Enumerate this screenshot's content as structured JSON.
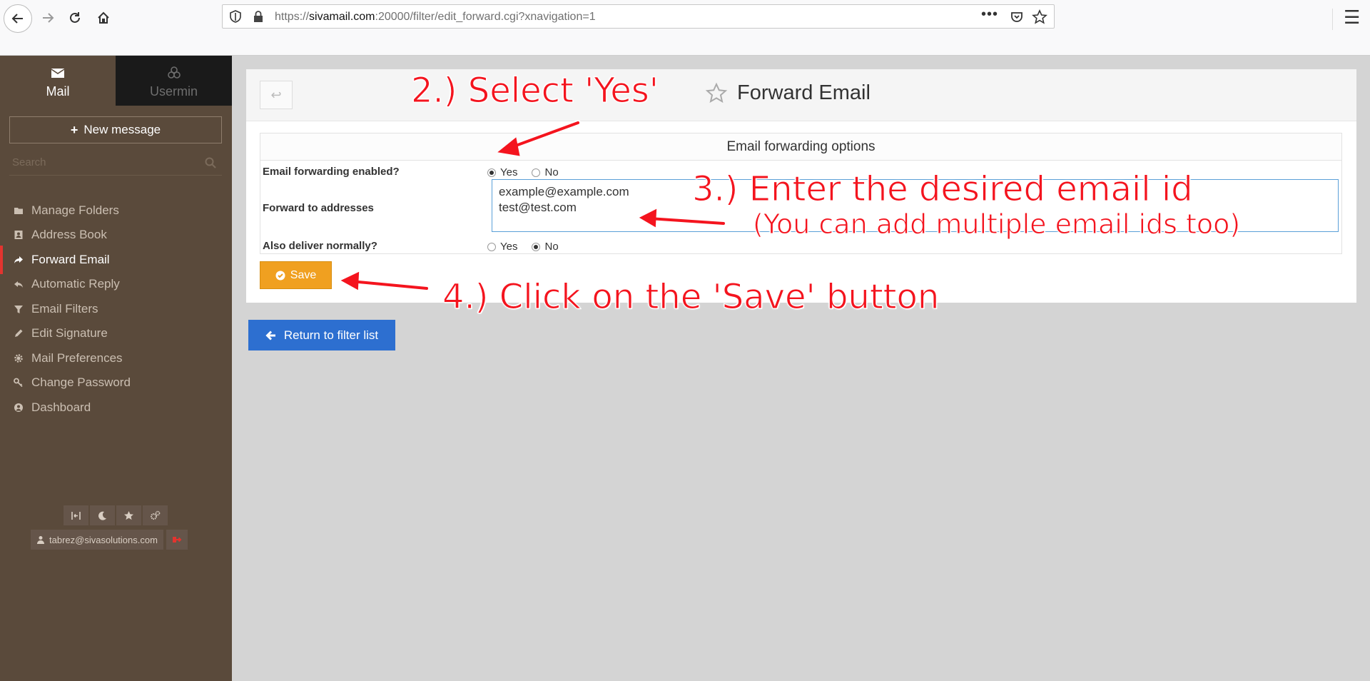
{
  "browser": {
    "url_prefix": "https://",
    "url_domain": "sivamail.com",
    "url_rest": ":20000/filter/edit_forward.cgi?xnavigation=1",
    "url_dots": "•••"
  },
  "sidebar": {
    "tabs": [
      {
        "label": "Mail",
        "icon": "envelope-icon"
      },
      {
        "label": "Usermin",
        "icon": "usermin-logo-icon"
      }
    ],
    "new_message_label": "New message",
    "search_placeholder": "Search",
    "items": [
      {
        "label": "Manage Folders",
        "icon": "folder-icon"
      },
      {
        "label": "Address Book",
        "icon": "address-book-icon"
      },
      {
        "label": "Forward Email",
        "icon": "share-icon",
        "active": true
      },
      {
        "label": "Automatic Reply",
        "icon": "reply-all-icon"
      },
      {
        "label": "Email Filters",
        "icon": "filter-icon"
      },
      {
        "label": "Edit Signature",
        "icon": "pencil-icon"
      },
      {
        "label": "Mail Preferences",
        "icon": "gear-icon"
      },
      {
        "label": "Change Password",
        "icon": "key-icon"
      },
      {
        "label": "Dashboard",
        "icon": "user-circle-icon"
      }
    ],
    "user_email": "tabrez@sivasolutions.com"
  },
  "main": {
    "page_title": "Forward Email",
    "back_symbol": "↩",
    "form": {
      "heading": "Email forwarding options",
      "forwarding_enabled_label": "Email forwarding enabled?",
      "forwarding_enabled_value": "Yes",
      "yes_label": "Yes",
      "no_label": "No",
      "forward_to_label": "Forward to addresses",
      "forward_to_value": "example@example.com\ntest@test.com",
      "deliver_normally_label": "Also deliver normally?",
      "deliver_normally_value": "No"
    },
    "save_label": "Save",
    "return_label": "Return to filter list"
  },
  "annotations": {
    "step2": "2.) Select 'Yes'",
    "step3_line1": "3.) Enter the desired email id",
    "step3_line2": "(You can add multiple email ids too)",
    "step4": "4.) Click on the 'Save' button",
    "color": "#f4141e"
  },
  "colors": {
    "sidebar_bg": "#5a4a3b",
    "active_accent": "#e3342f",
    "save_button": "#f0a020",
    "return_button": "#2d6fd0"
  }
}
